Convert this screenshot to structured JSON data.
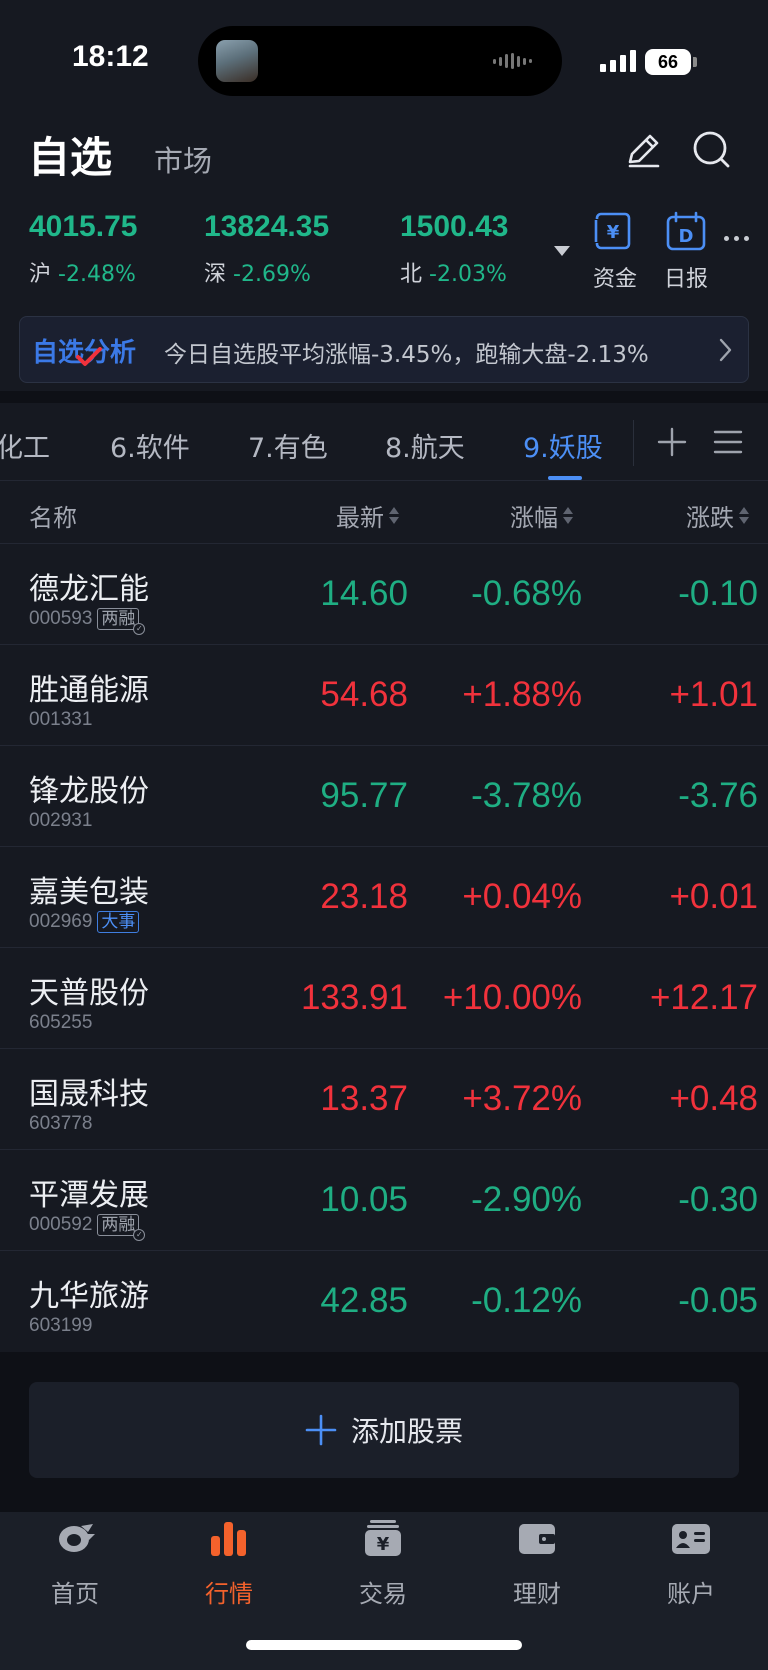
{
  "status_bar": {
    "time": "18:12",
    "battery": "66"
  },
  "header": {
    "title": "自选",
    "market_tab": "市场"
  },
  "indices": [
    {
      "value": "4015.75",
      "name": "沪",
      "change": "-2.48%"
    },
    {
      "value": "13824.35",
      "name": "深",
      "change": "-2.69%"
    },
    {
      "value": "1500.43",
      "name": "北",
      "change": "-2.03%"
    }
  ],
  "tools": {
    "funds_label": "资金",
    "daily_label": "日报",
    "funds_icon": "¥",
    "daily_icon": "D"
  },
  "banner": {
    "logo": "自选分析",
    "text": "今日自选股平均涨幅-3.45%，跑输大盘-2.13%"
  },
  "group_tabs": [
    "化工",
    "6.软件",
    "7.有色",
    "8.航天",
    "9.妖股"
  ],
  "active_group": "9.妖股",
  "columns": {
    "name": "名称",
    "latest": "最新",
    "pct": "涨幅",
    "change": "涨跌"
  },
  "stocks": [
    {
      "name": "德龙汇能",
      "code": "000593",
      "tag": "两融",
      "price": "14.60",
      "pct": "-0.68%",
      "change": "-0.10",
      "dir": "down"
    },
    {
      "name": "胜通能源",
      "code": "001331",
      "tag": "",
      "price": "54.68",
      "pct": "+1.88%",
      "change": "+1.01",
      "dir": "up"
    },
    {
      "name": "锋龙股份",
      "code": "002931",
      "tag": "",
      "price": "95.77",
      "pct": "-3.78%",
      "change": "-3.76",
      "dir": "down"
    },
    {
      "name": "嘉美包装",
      "code": "002969",
      "tag": "大事",
      "price": "23.18",
      "pct": "+0.04%",
      "change": "+0.01",
      "dir": "up"
    },
    {
      "name": "天普股份",
      "code": "605255",
      "tag": "",
      "price": "133.91",
      "pct": "+10.00%",
      "change": "+12.17",
      "dir": "up"
    },
    {
      "name": "国晟科技",
      "code": "603778",
      "tag": "",
      "price": "13.37",
      "pct": "+3.72%",
      "change": "+0.48",
      "dir": "up"
    },
    {
      "name": "平潭发展",
      "code": "000592",
      "tag": "两融",
      "price": "10.05",
      "pct": "-2.90%",
      "change": "-0.30",
      "dir": "down"
    },
    {
      "name": "九华旅游",
      "code": "603199",
      "tag": "",
      "price": "42.85",
      "pct": "-0.12%",
      "change": "-0.05",
      "dir": "down"
    }
  ],
  "add_button": "添加股票",
  "bottom_nav": [
    {
      "label": "首页",
      "icon": "home-icon"
    },
    {
      "label": "行情",
      "icon": "market-chart-icon",
      "active": true
    },
    {
      "label": "交易",
      "icon": "trade-icon"
    },
    {
      "label": "理财",
      "icon": "wallet-icon"
    },
    {
      "label": "账户",
      "icon": "account-card-icon"
    }
  ],
  "colors": {
    "up": "#f1323c",
    "down": "#1fae83",
    "accent": "#4c8ff5",
    "nav_active": "#f4622c"
  }
}
